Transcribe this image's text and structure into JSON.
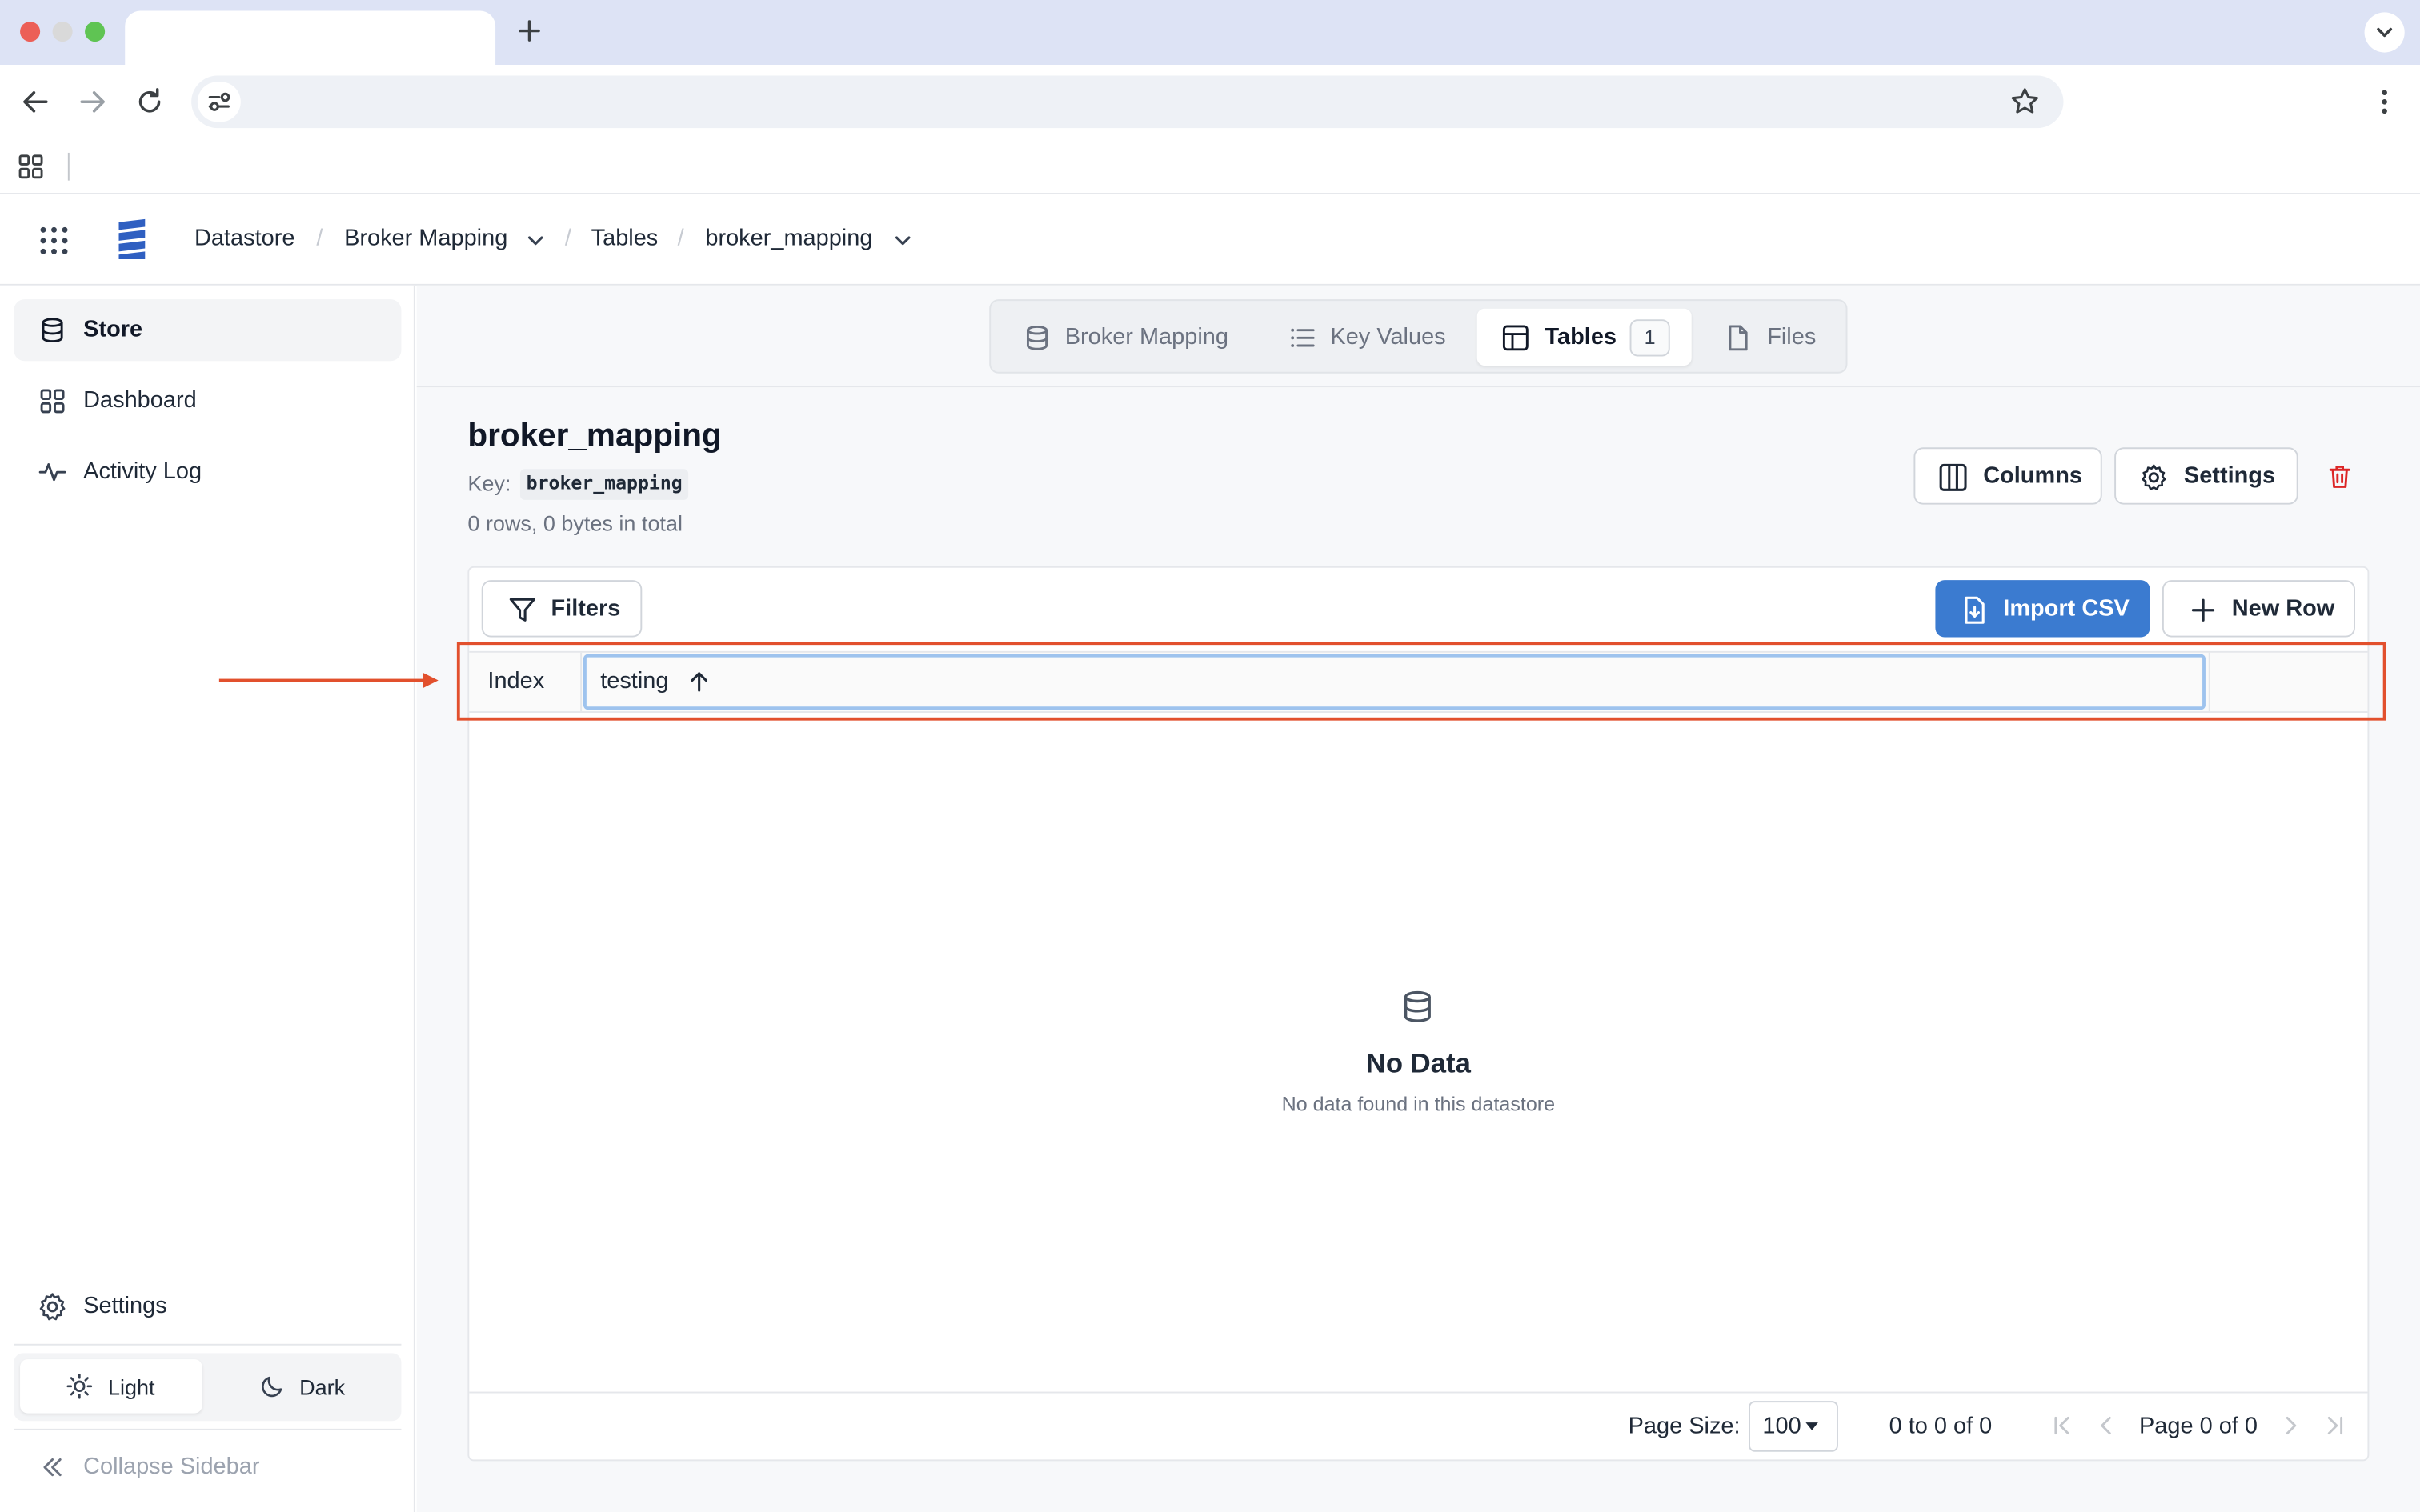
{
  "browser": {
    "tab_title": "",
    "address": "",
    "new_tab_icon": "plus-icon",
    "tab_list_icon": "chevron-down-icon"
  },
  "header": {
    "breadcrumbs": [
      {
        "label": "Datastore",
        "dropdown": false
      },
      {
        "label": "Broker Mapping",
        "dropdown": true
      },
      {
        "label": "Tables",
        "dropdown": false
      },
      {
        "label": "broker_mapping",
        "dropdown": true
      }
    ]
  },
  "sidebar": {
    "items": [
      {
        "label": "Store",
        "icon": "database-icon",
        "active": true
      },
      {
        "label": "Dashboard",
        "icon": "dashboard-icon",
        "active": false
      },
      {
        "label": "Activity Log",
        "icon": "activity-icon",
        "active": false
      }
    ],
    "settings_label": "Settings",
    "theme": {
      "light_label": "Light",
      "dark_label": "Dark",
      "selected": "Light"
    },
    "collapse_label": "Collapse Sidebar"
  },
  "store_tabs": [
    {
      "label": "Broker Mapping",
      "icon": "database-icon",
      "active": false
    },
    {
      "label": "Key Values",
      "icon": "list-icon",
      "active": false
    },
    {
      "label": "Tables",
      "icon": "table-icon",
      "active": true,
      "count": "1"
    },
    {
      "label": "Files",
      "icon": "file-icon",
      "active": false
    }
  ],
  "table": {
    "title": "broker_mapping",
    "key_label": "Key:",
    "key_value": "broker_mapping",
    "summary": "0 rows, 0 bytes in total",
    "columns_button": "Columns",
    "settings_button": "Settings",
    "filters_button": "Filters",
    "import_button": "Import CSV",
    "new_row_button": "New Row",
    "column_headers": [
      "Index",
      "testing"
    ],
    "sort": {
      "column": "testing",
      "direction": "ascending"
    },
    "empty_title": "No Data",
    "empty_subtitle": "No data found in this datastore"
  },
  "pagination": {
    "page_size_label": "Page Size:",
    "page_size_value": "100",
    "range_text": "0 to 0 of 0",
    "page_text": "Page 0 of 0"
  },
  "colors": {
    "accent": "#3b7bd0",
    "annotation": "#e2502d",
    "delete": "#dc2626"
  }
}
